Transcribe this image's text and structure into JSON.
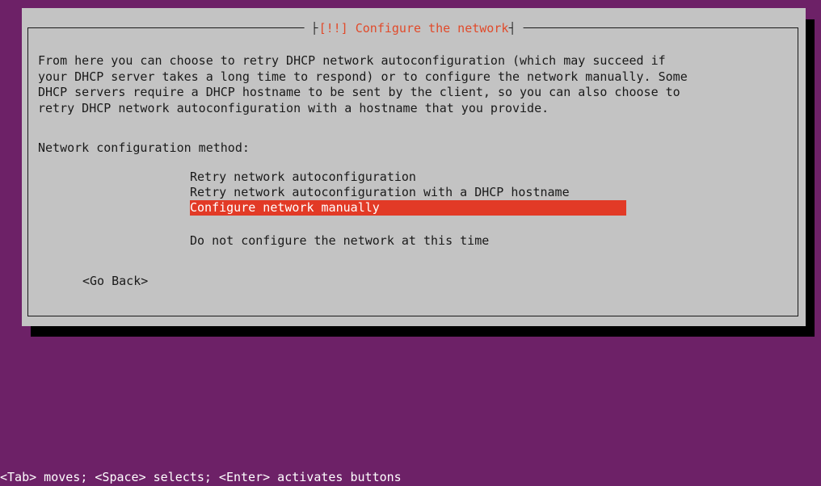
{
  "dialog": {
    "title": "[!!] Configure the network",
    "description": "From here you can choose to retry DHCP network autoconfiguration (which may succeed if\nyour DHCP server takes a long time to respond) or to configure the network manually. Some\nDHCP servers require a DHCP hostname to be sent by the client, so you can also choose to\nretry DHCP network autoconfiguration with a hostname that you provide.",
    "method_label": "Network configuration method:",
    "options": [
      {
        "label": "Retry network autoconfiguration",
        "selected": false
      },
      {
        "label": "Retry network autoconfiguration with a DHCP hostname",
        "selected": false
      },
      {
        "label": "Configure network manually",
        "selected": true
      },
      {
        "label": "Do not configure the network at this time",
        "selected": false
      }
    ],
    "go_back_label": "<Go Back>"
  },
  "status_bar": {
    "text": "<Tab> moves; <Space> selects; <Enter> activates buttons"
  },
  "colors": {
    "background": "#6d2167",
    "dialog": "#c3c3c3",
    "title": "#e14a2a",
    "selection": "#e23a26",
    "shadow": "#000000"
  }
}
